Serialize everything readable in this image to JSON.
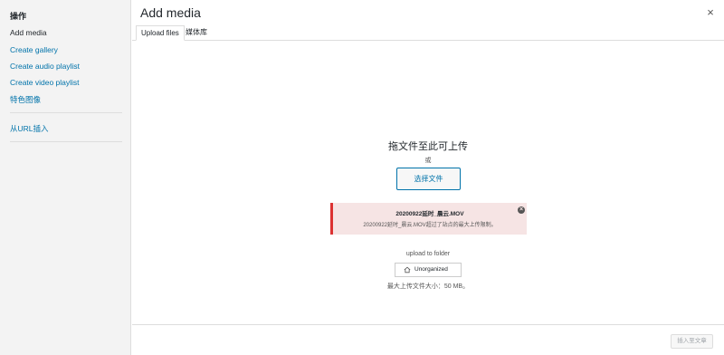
{
  "sidebar": {
    "heading": "操作",
    "items": [
      {
        "label": "Add media"
      },
      {
        "label": "Create gallery"
      },
      {
        "label": "Create audio playlist"
      },
      {
        "label": "Create video playlist"
      },
      {
        "label": "特色图像"
      },
      {
        "label": "从URL插入"
      }
    ]
  },
  "header": {
    "title": "Add media",
    "close_icon": "close-icon"
  },
  "tabs": [
    {
      "label": "Upload files",
      "active": true
    },
    {
      "label": "媒体库",
      "active": false
    }
  ],
  "uploader": {
    "drop_title": "拖文件至此可上传",
    "or_text": "或",
    "select_button": "选择文件",
    "error": {
      "filename": "20200922延时_晨云.MOV",
      "message": "20200922延时_晨云.MOV超过了站点的最大上传限制。",
      "dismiss_icon": "close-circle-icon"
    },
    "folder_label": "upload to folder",
    "folder_value": "Unorganized",
    "folder_icon": "home-icon",
    "max_size": "最大上传文件大小：50 MB。"
  },
  "toolbar": {
    "insert_button": "插入至文章"
  },
  "colors": {
    "accent": "#0073aa",
    "error": "#dc3232",
    "error_bg": "#f6e4e4",
    "sidebar_bg": "#f3f3f3"
  }
}
